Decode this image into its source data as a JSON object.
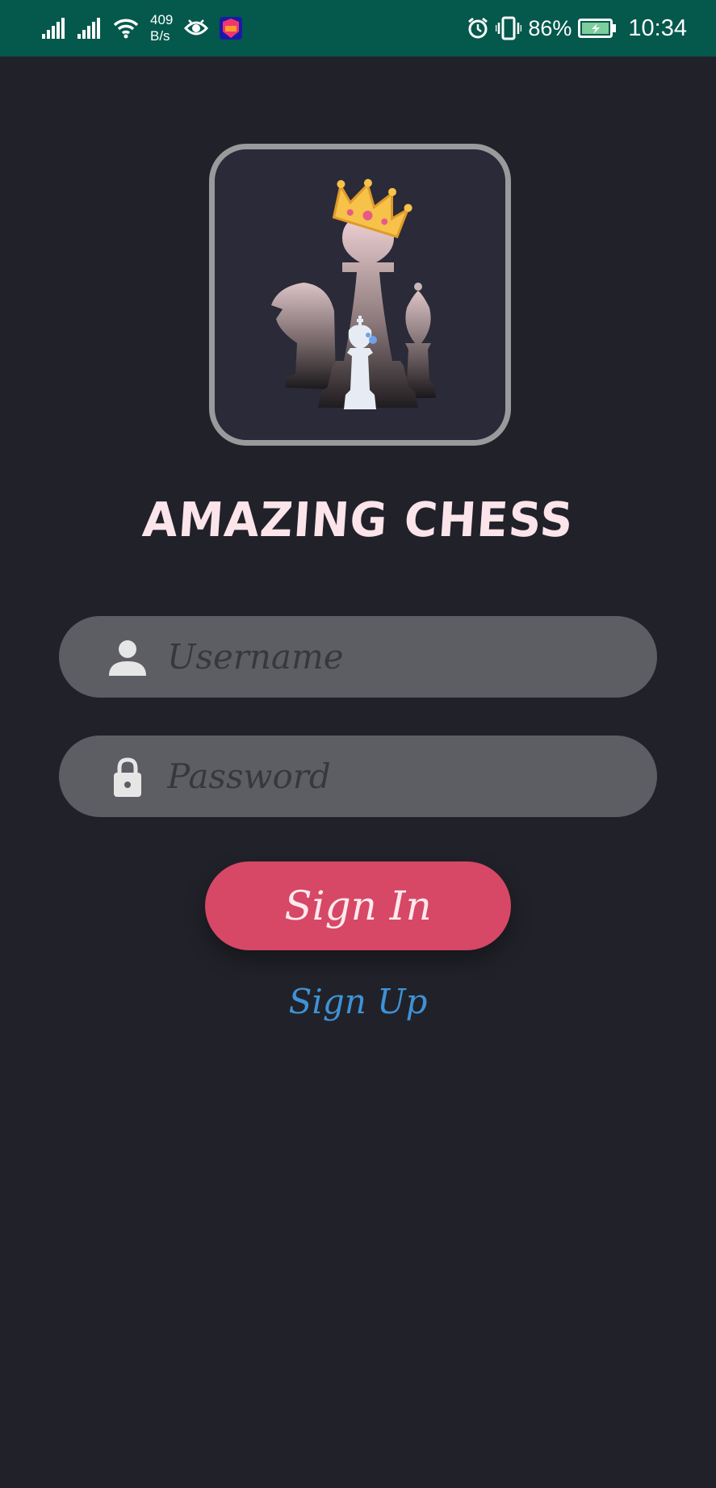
{
  "status_bar": {
    "net_speed_value": "409",
    "net_speed_unit": "B/s",
    "battery_percent": "86%",
    "time": "10:34",
    "icons": [
      "signal-icon",
      "signal-icon",
      "wifi-icon",
      "eye-icon",
      "lazada-app-icon",
      "alarm-icon",
      "vibrate-icon",
      "battery-charging-icon"
    ],
    "background": "#04584c"
  },
  "app": {
    "logo_icon": "chess-pieces-crown-logo",
    "title": "AMAZING CHESS"
  },
  "form": {
    "username_placeholder": "Username",
    "username_icon": "person-icon",
    "password_placeholder": "Password",
    "password_icon": "lock-icon",
    "signin_label": "Sign In",
    "signup_label": "Sign Up"
  },
  "colors": {
    "background": "#212229",
    "field": "#5d5e63",
    "signin_button": "#d64866",
    "signup_link": "#3f92d6",
    "title": "#fbe4ea"
  }
}
